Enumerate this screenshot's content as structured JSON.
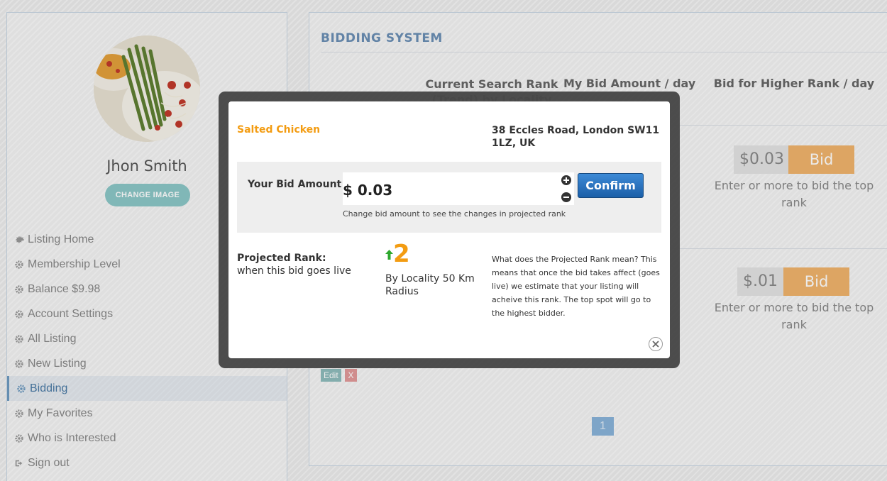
{
  "profile": {
    "name": "Jhon Smith",
    "change_image_label": "CHANGE IMAGE"
  },
  "sidebar": {
    "items": [
      {
        "label": "Listing Home",
        "icon": "gear-icon"
      },
      {
        "label": "Membership Level",
        "icon": "gear-icon"
      },
      {
        "label": "Balance $9.98",
        "icon": "gear-icon"
      },
      {
        "label": "Account Settings",
        "icon": "gear-icon"
      },
      {
        "label": "All Listing",
        "icon": "gear-icon"
      },
      {
        "label": "New Listing",
        "icon": "gear-icon"
      },
      {
        "label": "Bidding",
        "icon": "gear-icon",
        "active": true
      },
      {
        "label": "My Favorites",
        "icon": "gear-icon"
      },
      {
        "label": "Who is Interested",
        "icon": "gear-icon"
      },
      {
        "label": "Sign out",
        "icon": "sign-out-icon"
      }
    ]
  },
  "main": {
    "title": "BIDDING SYSTEM",
    "columns": [
      "Current Search Rank (Trend) by Locality [50",
      "My Bid Amount / day",
      "Bid for Higher Rank / day"
    ],
    "rows": [
      {
        "higher_bid": "$0.03",
        "bid_label": "Bid",
        "note": "Enter or more to bid the top rank"
      },
      {
        "higher_bid": "$.01",
        "bid_label": "Bid",
        "note": "Enter or more to bid the top rank"
      }
    ],
    "edit_label": "Edit",
    "delete_label": "X",
    "page": "1"
  },
  "modal": {
    "listing_name": "Salted Chicken",
    "address": "38 Eccles Road, London SW11 1LZ, UK",
    "bid_label": "Your Bid Amount",
    "bid_value": "$ 0.03",
    "confirm_label": "Confirm",
    "bid_hint": "Change bid amount to see the changes in projected rank",
    "projected_label": "Projected Rank:",
    "projected_sub": "when this bid goes live",
    "rank": "2",
    "rank_trend": "up",
    "rank_scope": "By Locality 50 Km Radius",
    "help_text": "What does the Projected Rank mean? This means that once the bid takes affect (goes live) we estimate that your listing will acheive this rank. The top spot will go to the highest bidder."
  },
  "colors": {
    "accent_orange": "#f39c12",
    "confirm_blue": "#1b5fa8",
    "trend_green": "#2ea82e",
    "title_blue": "#6b8fb5"
  }
}
